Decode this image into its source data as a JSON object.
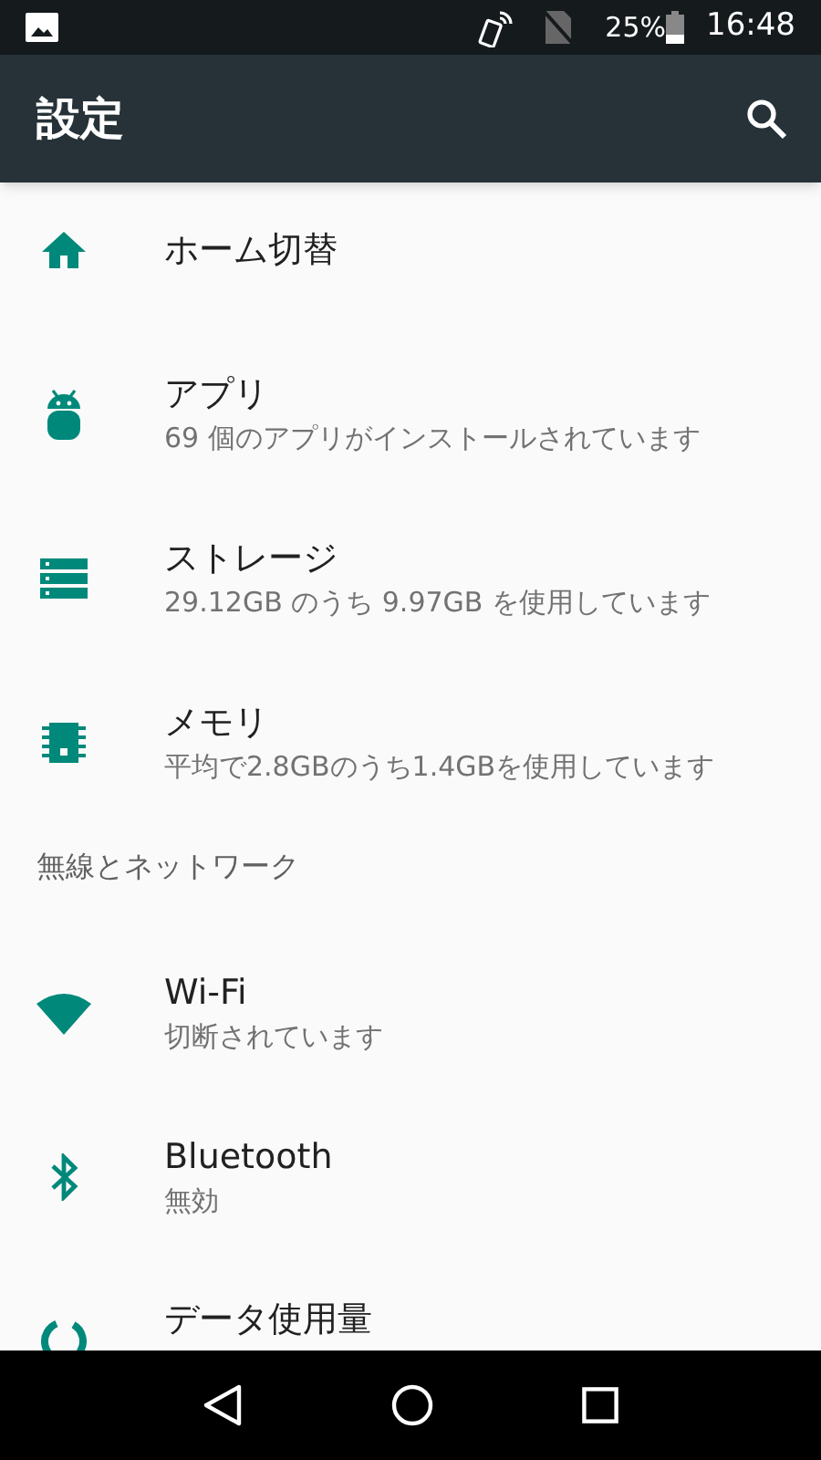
{
  "status_bar": {
    "battery": "25%",
    "time": "16:48"
  },
  "app_bar": {
    "title": "設定"
  },
  "list": [
    {
      "kind": "item",
      "title": "ホーム切替"
    },
    {
      "kind": "item",
      "title": "アプリ",
      "subtitle": "69 個のアプリがインストールされています"
    },
    {
      "kind": "item",
      "title": "ストレージ",
      "subtitle": "29.12GB のうち 9.97GB を使用しています"
    },
    {
      "kind": "item",
      "title": "メモリ",
      "subtitle": "平均で2.8GBのうち1.4GBを使用しています"
    },
    {
      "kind": "header",
      "title": "無線とネットワーク"
    },
    {
      "kind": "item",
      "title": "Wi-Fi",
      "subtitle": "切断されています"
    },
    {
      "kind": "item",
      "title": "Bluetooth",
      "subtitle": "無効"
    },
    {
      "kind": "item",
      "title": "データ使用量"
    }
  ]
}
